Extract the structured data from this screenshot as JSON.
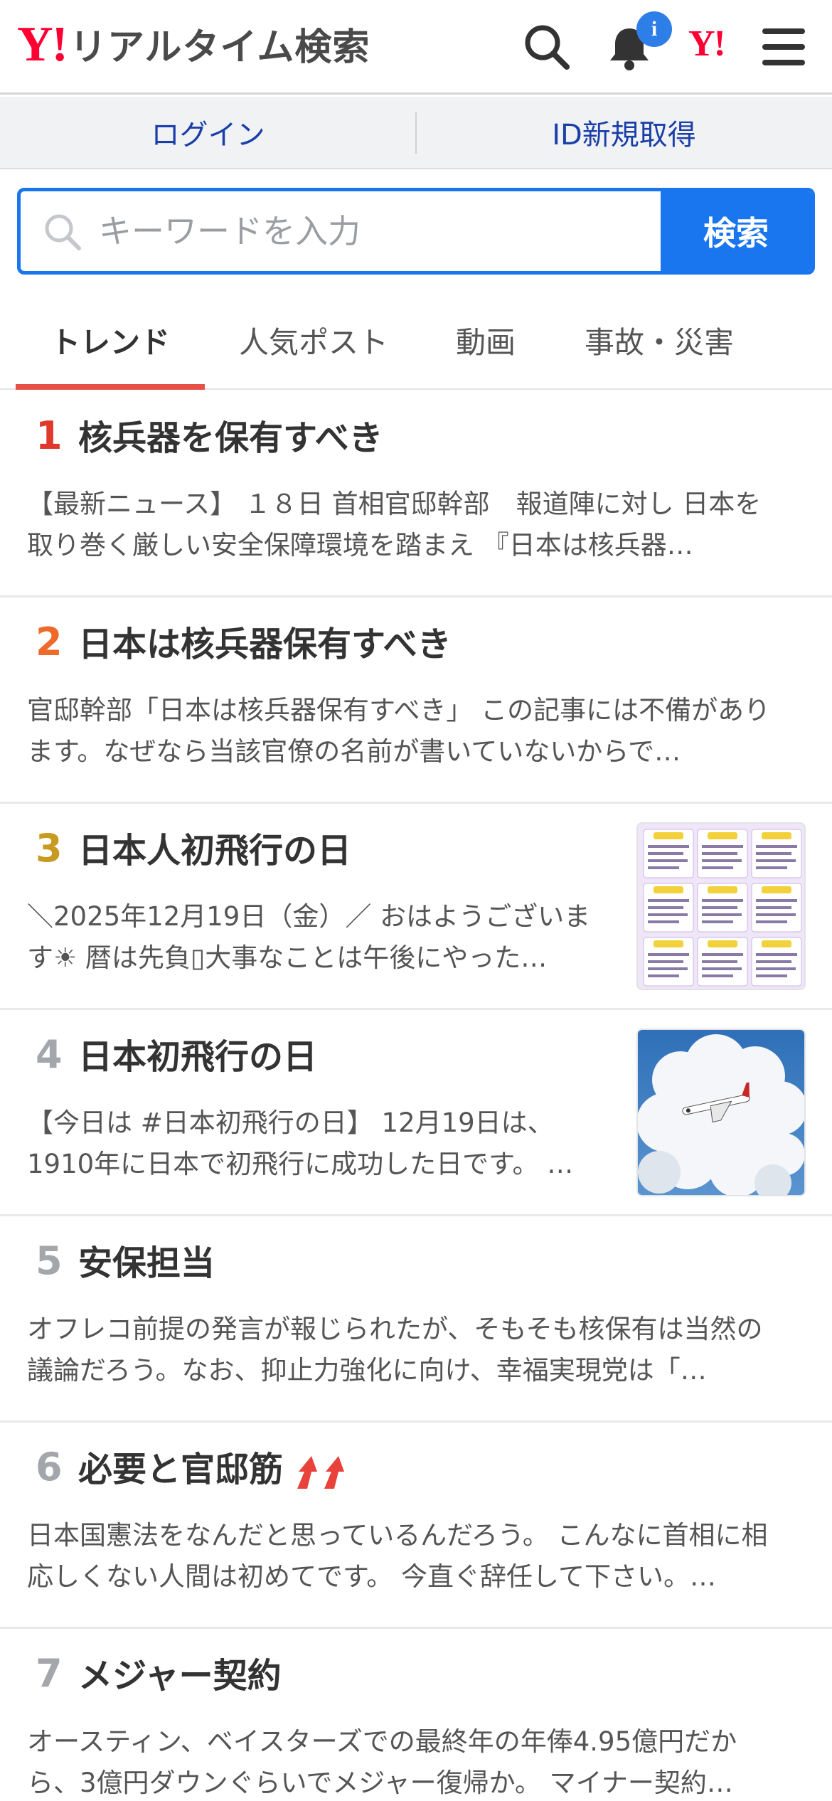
{
  "header": {
    "logo_mark": "Y!",
    "logo_text": "リアルタイム検索",
    "notification_badge": "i",
    "yahoo_mark": "Y!"
  },
  "account": {
    "login_label": "ログイン",
    "register_label": "ID新規取得"
  },
  "search": {
    "placeholder": "キーワードを入力",
    "button_label": "検索"
  },
  "tabs": [
    {
      "label": "トレンド",
      "active": true
    },
    {
      "label": "人気ポスト",
      "active": false
    },
    {
      "label": "動画",
      "active": false
    },
    {
      "label": "事故・災害",
      "active": false
    }
  ],
  "colors": {
    "accent": "#1a76ee",
    "brand": "#ff0033",
    "tab_indicator": "#e85148",
    "rank1": "#e0392c",
    "rank2": "#ee6a2a",
    "rank3": "#c89a22",
    "rank_other": "#a3a6aa"
  },
  "trends": [
    {
      "rank": "1",
      "title": "核兵器を保有すべき",
      "description": "【最新ニュース】 １８日 首相官邸幹部　報道陣に対し 日本を取り巻く厳しい安全保障環境を踏まえ 『日本は核兵器…",
      "thumbnail": null
    },
    {
      "rank": "2",
      "title": "日本は核兵器保有すべき",
      "description": "官邸幹部「日本は核兵器保有すべき」 この記事には不備があります。なぜなら当該官僚の名前が書いていないからで…",
      "thumbnail": null
    },
    {
      "rank": "3",
      "title": "日本人初飛行の日",
      "description": "＼2025年12月19日（金）／ おはようございます☀ 暦は先負▯大事なことは午後にやった…",
      "thumbnail": "fortune-grid-image"
    },
    {
      "rank": "4",
      "title": "日本初飛行の日",
      "description": "【今日は #日本初飛行の日】 12月19日は、1910年に日本で初飛行に成功した日です。 …",
      "thumbnail": "airplane-clouds-image"
    },
    {
      "rank": "5",
      "title": "安保担当",
      "description": "オフレコ前提の発言が報じられたが、そもそも核保有は当然の議論だろう。なお、抑止力強化に向け、幸福実現党は「…",
      "thumbnail": null
    },
    {
      "rank": "6",
      "title": "必要と官邸筋",
      "description": "日本国憲法をなんだと思っているんだろう。 こんなに首相に相応しくない人間は初めてです。 今直ぐ辞任して下さい。…",
      "thumbnail": null,
      "trending_icon": "rising-arrows-icon"
    },
    {
      "rank": "7",
      "title": "メジャー契約",
      "description": "オースティン、ベイスターズでの最終年の年俸4.95億円だから、3億円ダウンぐらいでメジャー復帰か。 マイナー契約…",
      "thumbnail": null
    }
  ]
}
